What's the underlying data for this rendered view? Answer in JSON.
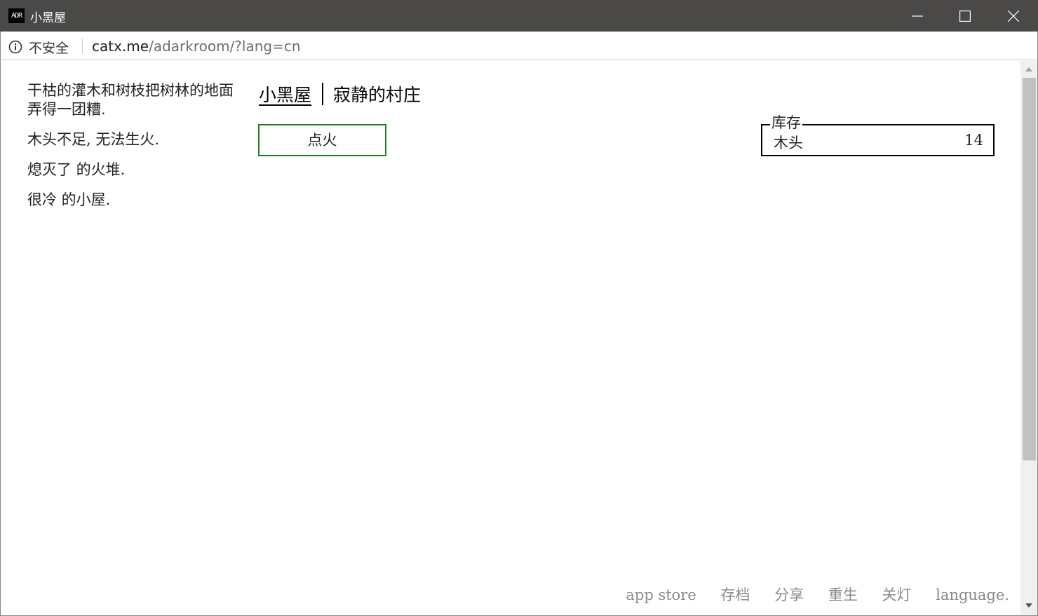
{
  "window": {
    "app_icon_text": "ADR",
    "title": "小黑屋"
  },
  "addressbar": {
    "security_label": "不安全",
    "url_host": "catx.me",
    "url_path": "/adarkroom/?lang=cn"
  },
  "notifications": [
    "干枯的灌木和树枝把树林的地面弄得一团糟.",
    "木头不足, 无法生火.",
    "熄灭了 的火堆.",
    "很冷 的小屋."
  ],
  "header": {
    "tabs": [
      {
        "label": "小黑屋",
        "active": true
      },
      {
        "label": "寂静的村庄",
        "active": false
      }
    ]
  },
  "buttons": {
    "light_fire": "点火"
  },
  "stores": {
    "legend": "库存",
    "items": [
      {
        "name": "木头",
        "value": "14"
      }
    ]
  },
  "footer": {
    "links": [
      "app store",
      "存档",
      "分享",
      "重生",
      "关灯",
      "language."
    ]
  },
  "colors": {
    "titlebar": "#4a4948",
    "button_border": "#1a7f1a",
    "footer_text": "#8a8a8a"
  }
}
